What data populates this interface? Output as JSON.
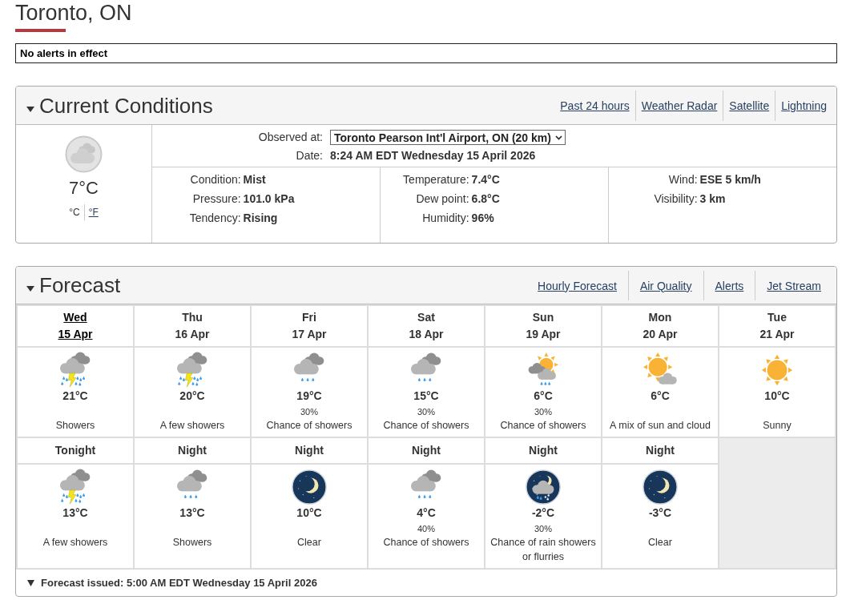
{
  "page_title": "Toronto, ON",
  "alert_banner": "No alerts in effect",
  "current_conditions": {
    "title": "Current Conditions",
    "expanded": true,
    "links": [
      "Past 24 hours",
      "Weather Radar",
      "Satellite",
      "Lightning"
    ],
    "temperature": "7°C",
    "units": [
      {
        "label": "°C",
        "selected": true
      },
      {
        "label": "°F",
        "selected": false
      }
    ],
    "observed_at": {
      "label": "Observed at:",
      "value": "Toronto Pearson Int'l Airport, ON (20 km)"
    },
    "date": {
      "label": "Date:",
      "value": "8:24 AM EDT Wednesday 15 April 2026"
    },
    "columns": [
      {
        "rows": [
          {
            "label": "Condition:",
            "value": "Mist"
          },
          {
            "label": "Pressure:",
            "value": "101.0 kPa"
          },
          {
            "label": "Tendency:",
            "value": "Rising"
          }
        ]
      },
      {
        "rows": [
          {
            "label": "Temperature:",
            "value": "7.4°C"
          },
          {
            "label": "Dew point:",
            "value": "6.8°C"
          },
          {
            "label": "Humidity:",
            "value": "96%"
          }
        ]
      },
      {
        "rows": [
          {
            "label": "Wind:",
            "value": "ESE 5 km/h"
          },
          {
            "label": "Visibility:",
            "value": "3 km"
          }
        ]
      }
    ]
  },
  "forecast": {
    "title": "Forecast",
    "expanded": true,
    "links": [
      "Hourly Forecast",
      "Air Quality",
      "Alerts",
      "Jet Stream"
    ],
    "days": [
      {
        "day": "Wed",
        "date": "15 Apr",
        "selected": true,
        "kind": "thunderstorm",
        "temperature": "21°C",
        "summary": "Showers"
      },
      {
        "day": "Thu",
        "date": "16 Apr",
        "selected": false,
        "kind": "thunderstorm",
        "temperature": "20°C",
        "summary": "A few showers"
      },
      {
        "day": "Fri",
        "date": "17 Apr",
        "selected": false,
        "kind": "rain",
        "temperature": "19°C",
        "precipitation_chance": "30%",
        "summary": "Chance of showers"
      },
      {
        "day": "Sat",
        "date": "18 Apr",
        "selected": false,
        "kind": "rain",
        "temperature": "15°C",
        "precipitation_chance": "30%",
        "summary": "Chance of showers"
      },
      {
        "day": "Sun",
        "date": "19 Apr",
        "selected": false,
        "kind": "sun-rain",
        "temperature": "6°C",
        "precipitation_chance": "30%",
        "summary": "Chance of showers"
      },
      {
        "day": "Mon",
        "date": "20 Apr",
        "selected": false,
        "kind": "sun-cloud",
        "temperature": "6°C",
        "summary": "A mix of sun and cloud"
      },
      {
        "day": "Tue",
        "date": "21 Apr",
        "selected": false,
        "kind": "sun",
        "temperature": "10°C",
        "summary": "Sunny"
      }
    ],
    "nights": [
      {
        "label": "Tonight",
        "kind": "thunderstorm",
        "temperature": "13°C",
        "summary": "A few showers"
      },
      {
        "label": "Night",
        "kind": "rain",
        "temperature": "13°C",
        "summary": "Showers"
      },
      {
        "label": "Night",
        "kind": "moon",
        "temperature": "10°C",
        "summary": "Clear"
      },
      {
        "label": "Night",
        "kind": "rain",
        "temperature": "4°C",
        "precipitation_chance": "40%",
        "summary": "Chance of showers"
      },
      {
        "label": "Night",
        "kind": "moon-rain-snow",
        "temperature": "-2°C",
        "precipitation_chance": "30%",
        "summary": "Chance of rain showers or flurries"
      },
      {
        "label": "Night",
        "kind": "moon",
        "temperature": "-3°C",
        "summary": "Clear"
      }
    ],
    "issued": {
      "text": "Forecast issued: 5:00 AM EDT Wednesday 15 April 2026",
      "expanded": true
    }
  }
}
